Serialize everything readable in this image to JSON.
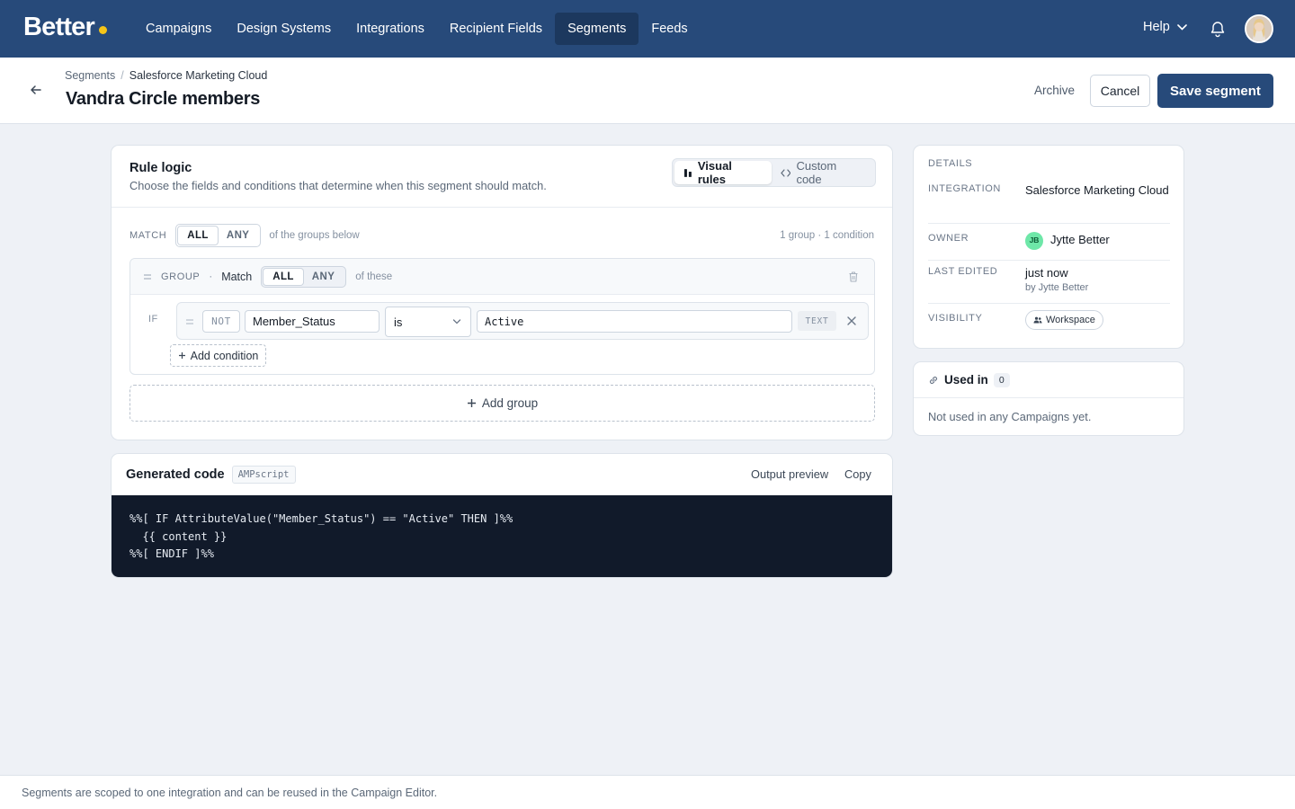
{
  "nav": {
    "logo": "Better",
    "links": [
      "Campaigns",
      "Design Systems",
      "Integrations",
      "Recipient Fields",
      "Segments",
      "Feeds"
    ],
    "active": "Segments",
    "help": "Help"
  },
  "header": {
    "breadcrumb_root": "Segments",
    "breadcrumb_current": "Salesforce Marketing Cloud",
    "title": "Vandra Circle members",
    "archive": "Archive",
    "cancel": "Cancel",
    "save": "Save segment"
  },
  "rule_logic": {
    "title": "Rule logic",
    "subtitle": "Choose the fields and conditions that determine when this segment should match.",
    "mode_visual": "Visual rules",
    "mode_code": "Custom code",
    "active_mode": "Visual rules",
    "match_label": "MATCH",
    "match_all": "ALL",
    "match_any": "ANY",
    "match_selected": "ALL",
    "match_suffix": "of the groups below",
    "counts": "1 group · 1 condition",
    "group": {
      "label": "GROUP",
      "match_label": "Match",
      "all": "ALL",
      "any": "ANY",
      "selected": "ALL",
      "suffix": "of these",
      "if_label": "IF",
      "condition": {
        "not_label": "NOT",
        "field": "Member_Status",
        "operator": "is",
        "value": "Active",
        "type": "TEXT"
      },
      "add_condition": "Add condition"
    },
    "add_group": "Add group"
  },
  "generated_code": {
    "title": "Generated code",
    "language": "AMPscript",
    "output_preview": "Output preview",
    "copy": "Copy",
    "line1": "%%[ IF AttributeValue(\"Member_Status\") == \"Active\" THEN ]%%",
    "line2": "  {{ content }}",
    "line3": "%%[ ENDIF ]%%"
  },
  "details": {
    "heading": "DETAILS",
    "integration_label": "INTEGRATION",
    "integration_value": "Salesforce Marketing Cloud",
    "owner_label": "OWNER",
    "owner_initials": "JB",
    "owner_name": "Jytte Better",
    "last_edited_label": "LAST EDITED",
    "last_edited_value": "just now",
    "last_edited_by": "by Jytte Better",
    "visibility_label": "VISIBILITY",
    "visibility_value": "Workspace"
  },
  "used_in": {
    "title": "Used in",
    "count": "0",
    "empty": "Not used in any Campaigns yet."
  },
  "footer": {
    "text": "Segments are scoped to one integration and can be reused in the Campaign Editor."
  },
  "colors": {
    "nav_bg": "#274a7a",
    "nav_active": "#1c385e",
    "logo_dot": "#f5c518",
    "primary_button": "#274a7a",
    "code_bg": "#111a2a",
    "owner_avatar": "#6ee7a8"
  },
  "icons": [
    "back-arrow-icon",
    "bell-icon",
    "chevron-down-icon",
    "visual-rules-icon",
    "code-icon",
    "drag-handle-icon",
    "trash-icon",
    "close-icon",
    "plus-icon",
    "link-icon",
    "users-icon"
  ]
}
